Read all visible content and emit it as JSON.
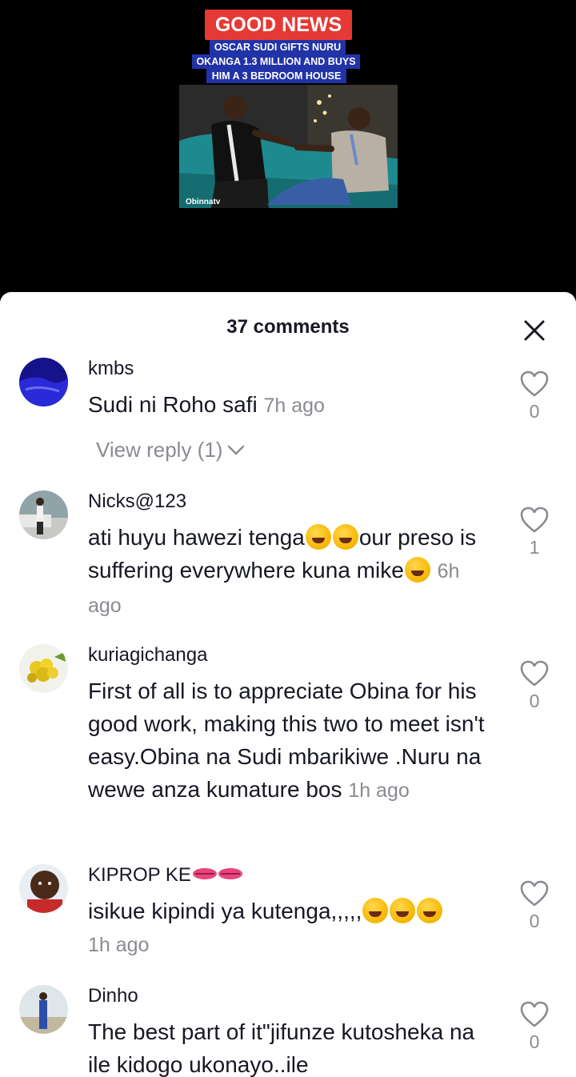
{
  "video": {
    "badge": "GOOD NEWS",
    "headline_lines": [
      "OSCAR SUDI GIFTS NURU",
      "OKANGA 1.3 MILLION AND BUYS",
      "HIM A 3 BEDROOM HOUSE"
    ],
    "watermark": "Obinnatv"
  },
  "sheet": {
    "title": "37 comments",
    "close_icon": "close-icon"
  },
  "comments": [
    {
      "user": "kmbs",
      "text": "Sudi ni Roho safi",
      "time": "7h ago",
      "likes": "0",
      "view_reply": "View reply (1)"
    },
    {
      "user": "Nicks@123",
      "text_part1": "ati huyu hawezi tenga",
      "text_part2": "our preso is suffering everywhere kuna mike",
      "time": "6h ago",
      "likes": "1"
    },
    {
      "user": "kuriagichanga",
      "text": "First of all is to appreciate Obina for his good work, making this two to meet isn't easy.Obina na Sudi mbarikiwe .Nuru na wewe anza kumature bos",
      "time": "1h ago",
      "likes": "0"
    },
    {
      "user": "KIPROP KE",
      "text": "isikue kipindi ya kutenga,,,,,",
      "time": "1h ago",
      "likes": "0"
    },
    {
      "user": "Dinho",
      "text": "The best part of it\"jifunze kutosheka na ile kidogo ukonayo..ile",
      "likes": "0"
    }
  ],
  "colors": {
    "badge_red": "#e53935",
    "headline_blue": "#2233a8",
    "text_primary": "#161823",
    "text_secondary": "#8a8b91"
  }
}
